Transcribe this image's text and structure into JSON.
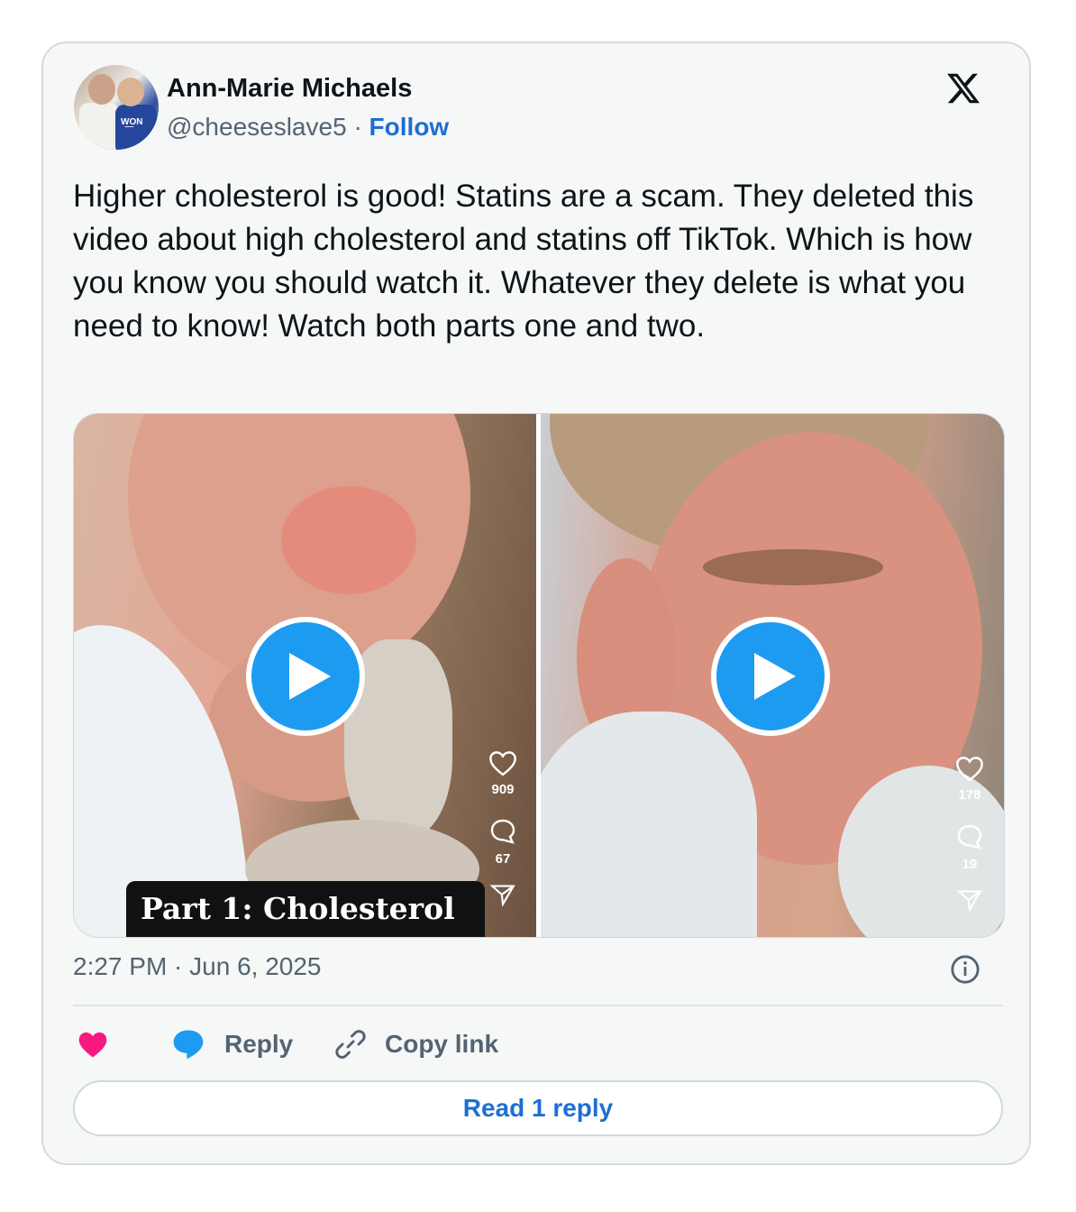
{
  "author": {
    "name": "Ann-Marie Michaels",
    "handle": "@cheeseslave5",
    "separator": "·",
    "follow_label": "Follow"
  },
  "tweet": {
    "text": "Higher cholesterol is good! Statins are a scam. They deleted this video about high cholesterol and statins off TikTok. Which is how you know you should watch it. Whatever they delete is what you need to know! Watch both parts one and two.",
    "timestamp": "2:27 PM · Jun 6, 2025"
  },
  "media": [
    {
      "likes": "909",
      "comments": "67",
      "caption": "Part 1: Cholesterol"
    },
    {
      "likes": "178",
      "comments": "19",
      "caption": ""
    }
  ],
  "actions": {
    "reply_label": "Reply",
    "copy_link_label": "Copy link",
    "read_replies_label": "Read 1 reply"
  },
  "colors": {
    "like": "#f91880",
    "reply_bubble": "#1d9bf0",
    "link": "#1d6fd1",
    "play": "#1d9bf0"
  },
  "icons": [
    "x-logo-icon",
    "play-icon",
    "heart-icon",
    "comment-icon",
    "share-icon",
    "info-icon",
    "like-icon",
    "reply-bubble-icon",
    "link-icon"
  ]
}
